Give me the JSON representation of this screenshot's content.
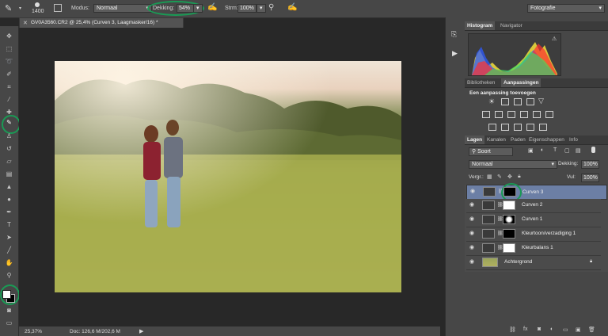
{
  "options_bar": {
    "brush_size": "1400",
    "mode_label": "Modus:",
    "mode_value": "Normaal",
    "opacity_label": "Dekking:",
    "opacity_value": "54%",
    "flow_label": "Strm:",
    "flow_value": "100%",
    "workspace": "Fotografie"
  },
  "document": {
    "tab_title": "GV0A3560.CR2 @ 25,4% (Curven 3, Laagmasker/16) *",
    "zoom": "25,37%",
    "doc_info": "Doc: 126,6 M/202,6 M"
  },
  "histogram_panel": {
    "tabs": [
      "Histogram",
      "Navigator"
    ]
  },
  "adjustments_panel": {
    "tabs": [
      "Bibliotheken",
      "Aanpassingen"
    ],
    "heading": "Een aanpassing toevoegen"
  },
  "layers_panel": {
    "tabs": [
      "Lagen",
      "Kanalen",
      "Paden",
      "Eigenschappen",
      "Info"
    ],
    "filter_label": "Soort",
    "blend_mode": "Normaal",
    "opacity_label": "Dekking:",
    "opacity_value": "100%",
    "lock_label": "Vergr.:",
    "fill_label": "Vul:",
    "fill_value": "100%",
    "layers": [
      {
        "name": "Curven 3",
        "selected": true
      },
      {
        "name": "Curven 2",
        "selected": false
      },
      {
        "name": "Curven 1",
        "selected": false
      },
      {
        "name": "Kleurtoon/verzadiging 1",
        "selected": false
      },
      {
        "name": "Kleurbalans 1",
        "selected": false
      },
      {
        "name": "Achtergrond",
        "selected": false
      }
    ]
  },
  "colors": {
    "accent_circle": "#1a9a55",
    "selected_layer": "#6c7fa5"
  }
}
